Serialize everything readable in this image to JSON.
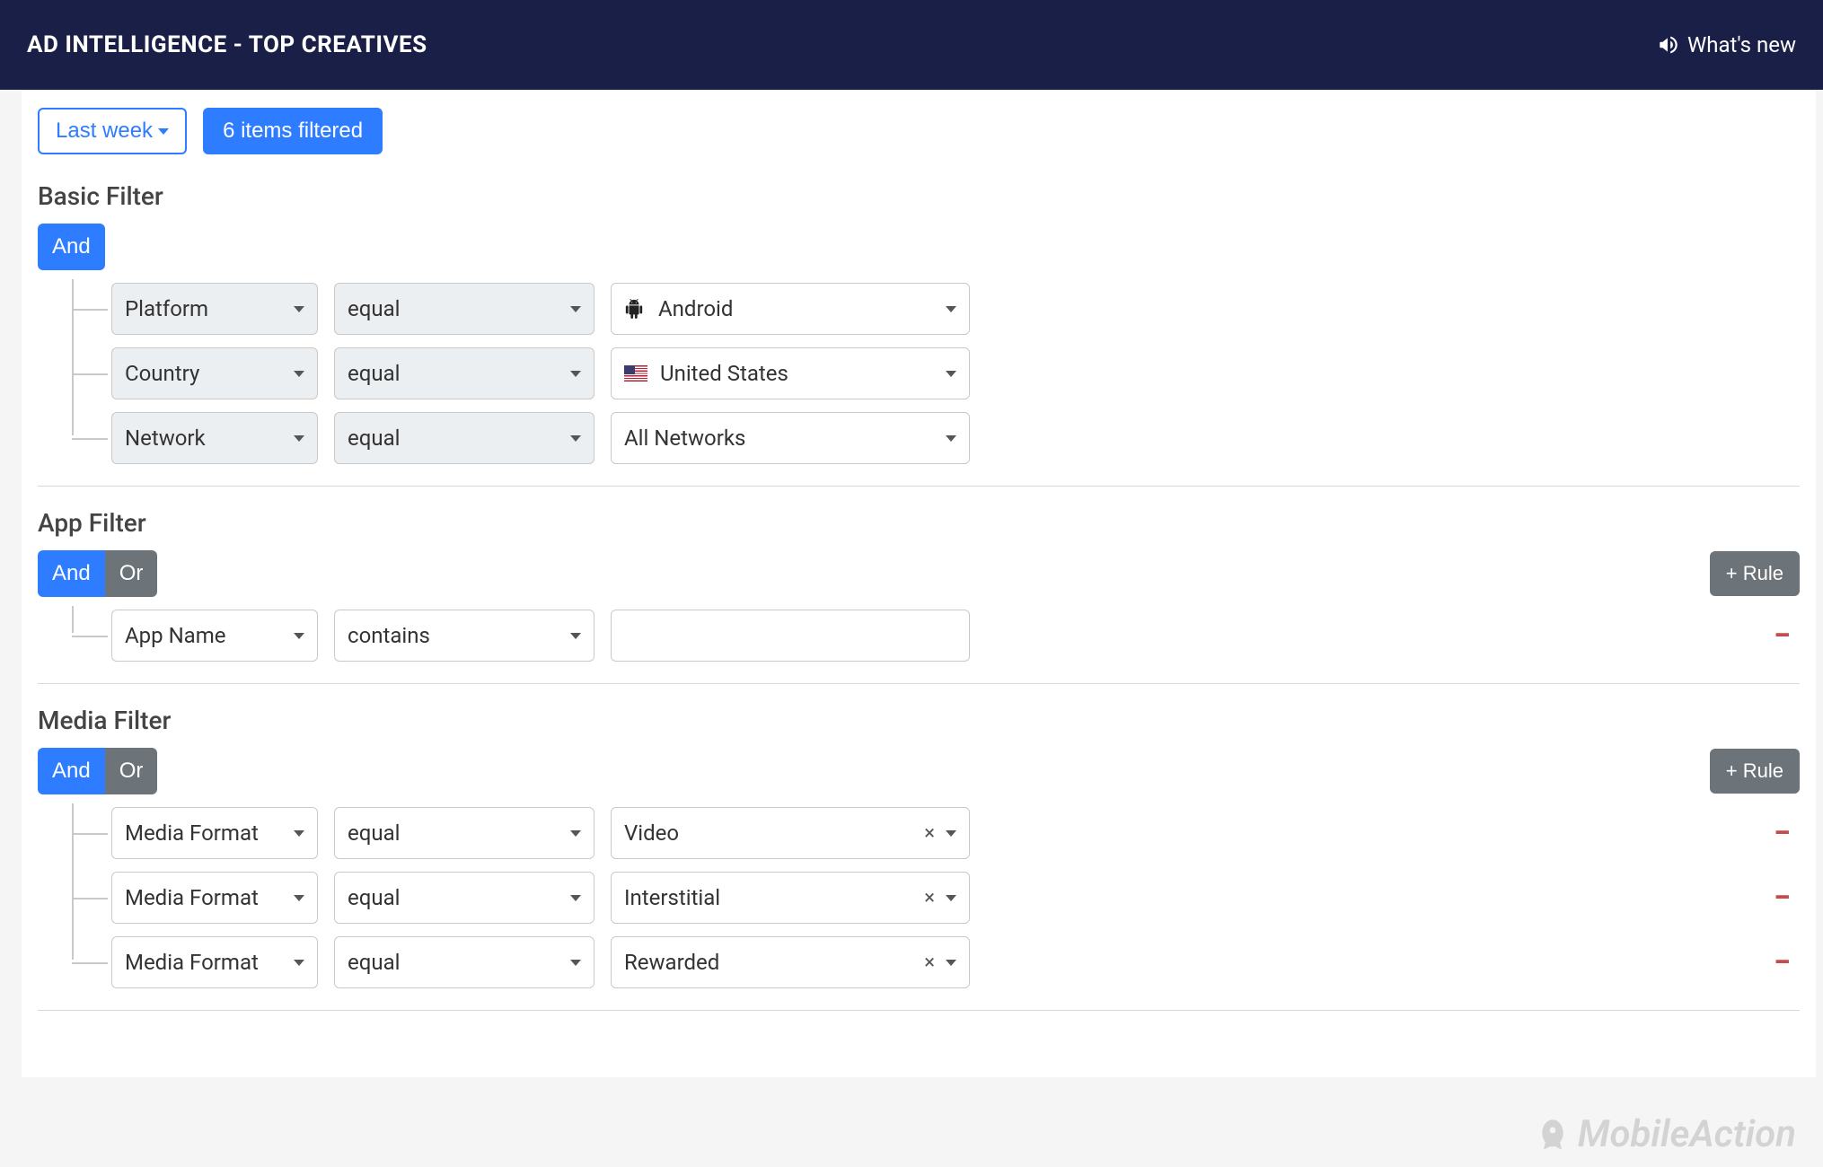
{
  "header": {
    "title": "AD INTELLIGENCE - TOP CREATIVES",
    "whats_new": "What's new"
  },
  "toolbar": {
    "daterange_label": "Last week",
    "filtered_badge": "6 items filtered"
  },
  "basic_filter": {
    "title": "Basic Filter",
    "logic_active": "And",
    "rules": [
      {
        "field": "Platform",
        "op": "equal",
        "value": "Android",
        "icon": "android"
      },
      {
        "field": "Country",
        "op": "equal",
        "value": "United States",
        "icon": "us-flag"
      },
      {
        "field": "Network",
        "op": "equal",
        "value": "All Networks",
        "icon": ""
      }
    ]
  },
  "app_filter": {
    "title": "App Filter",
    "logic_active": "And",
    "logic_inactive": "Or",
    "add_rule_label": "+ Rule",
    "rules": [
      {
        "field": "App Name",
        "op": "contains",
        "value": ""
      }
    ]
  },
  "media_filter": {
    "title": "Media Filter",
    "logic_active": "And",
    "logic_inactive": "Or",
    "add_rule_label": "+ Rule",
    "rules": [
      {
        "field": "Media Format",
        "op": "equal",
        "value": "Video"
      },
      {
        "field": "Media Format",
        "op": "equal",
        "value": "Interstitial"
      },
      {
        "field": "Media Format",
        "op": "equal",
        "value": "Rewarded"
      }
    ]
  },
  "footer": {
    "brand": "MobileAction"
  }
}
